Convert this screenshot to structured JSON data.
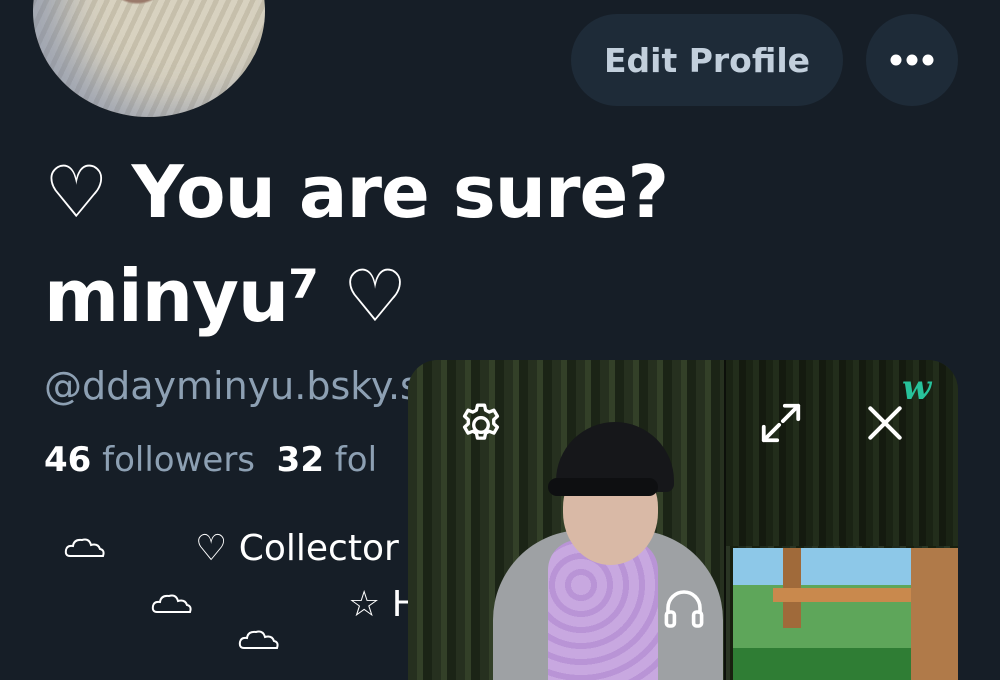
{
  "profile": {
    "display_name": "♡ You are sure? minyu⁷ ♡",
    "handle": "@ddayminyu.bsky.s",
    "followers_count": "46",
    "followers_label": "followers",
    "following_count": "32",
    "following_label": "fol"
  },
  "actions": {
    "edit_profile_label": "Edit Profile",
    "more_label": "•••"
  },
  "bio": {
    "line1": "♡ Collector",
    "line2": "☆ H"
  },
  "pip": {
    "logo": "w",
    "icons": [
      "gear-icon",
      "expand-icon",
      "close-icon",
      "headphones-icon",
      "cloud-icon"
    ]
  },
  "colors": {
    "background": "#161e27",
    "button_bg": "#1e2b38",
    "muted_text": "#8da0b3",
    "logo_accent": "#27c29b"
  }
}
